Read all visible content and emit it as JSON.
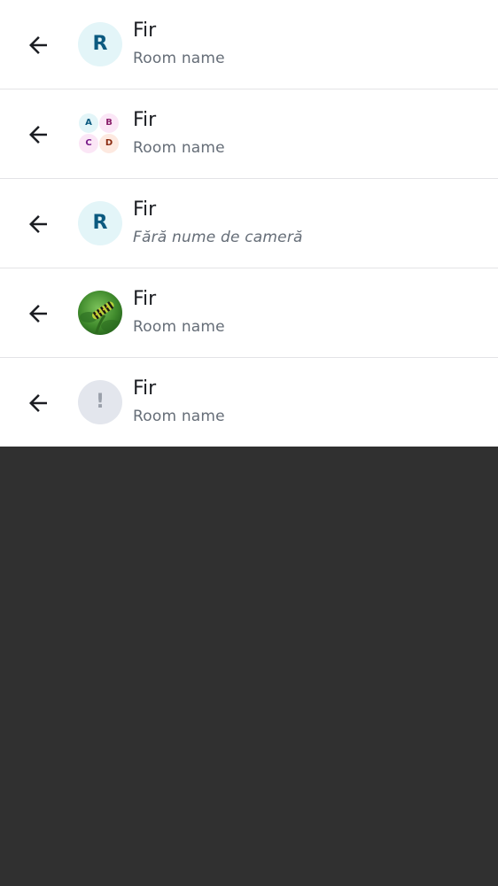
{
  "rows": [
    {
      "title": "Fir",
      "subtitle": "Room name",
      "avatar_kind": "letter",
      "avatar_text": "R"
    },
    {
      "title": "Fir",
      "subtitle": "Room name",
      "avatar_kind": "cluster",
      "cluster_letters": [
        "A",
        "B",
        "C",
        "D"
      ]
    },
    {
      "title": "Fir",
      "subtitle": "Fără nume de cameră",
      "avatar_kind": "letter",
      "avatar_text": "R"
    },
    {
      "title": "Fir",
      "subtitle": "Room name",
      "avatar_kind": "image",
      "image_desc": "caterpillar-photo"
    },
    {
      "title": "Fir",
      "subtitle": "Room name",
      "avatar_kind": "alert",
      "avatar_text": "!"
    }
  ],
  "icons": {
    "back": "arrow-left-icon"
  },
  "colors": {
    "list_background": "#ffffff",
    "page_background": "#303030",
    "title_text": "#1b1d22",
    "subtitle_text": "#656d77",
    "divider": "#e3e3e6"
  }
}
